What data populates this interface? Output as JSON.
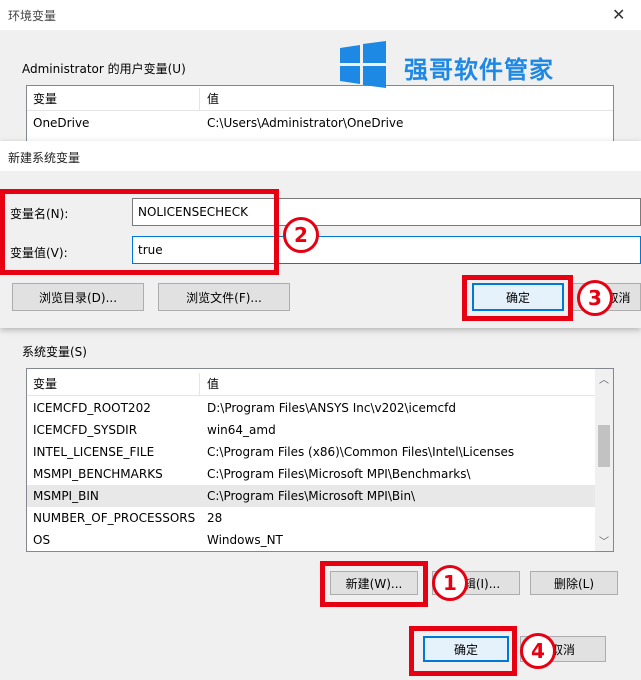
{
  "env_window": {
    "title": "环境变量",
    "close_icon": "close-icon",
    "user_section_label": "Administrator 的用户变量(U)",
    "user_vars": {
      "col_name": "变量",
      "col_value": "值",
      "rows": [
        {
          "name": "OneDrive",
          "value": "C:\\Users\\Administrator\\OneDrive"
        }
      ]
    },
    "sys_section_label": "系统变量(S)",
    "sys_vars": {
      "col_name": "变量",
      "col_value": "值",
      "rows": [
        {
          "name": "ICEMCFD_ROOT202",
          "value": "D:\\Program Files\\ANSYS Inc\\v202\\icemcfd"
        },
        {
          "name": "ICEMCFD_SYSDIR",
          "value": "win64_amd"
        },
        {
          "name": "INTEL_LICENSE_FILE",
          "value": "C:\\Program Files (x86)\\Common Files\\Intel\\Licenses"
        },
        {
          "name": "MSMPI_BENCHMARKS",
          "value": "C:\\Program Files\\Microsoft MPI\\Benchmarks\\"
        },
        {
          "name": "MSMPI_BIN",
          "value": "C:\\Program Files\\Microsoft MPI\\Bin\\"
        },
        {
          "name": "NUMBER_OF_PROCESSORS",
          "value": "28"
        },
        {
          "name": "OS",
          "value": "Windows_NT"
        }
      ]
    },
    "buttons": {
      "new": "新建(W)...",
      "edit": "编辑(I)...",
      "delete": "删除(L)",
      "ok": "确定",
      "cancel": "取消"
    }
  },
  "watermark": {
    "logo_icon": "windows-logo-icon",
    "text": "强哥软件管家",
    "color": "#1e88e5"
  },
  "new_var_dialog": {
    "title": "新建系统变量",
    "name_label": "变量名(N):",
    "name_value": "NOLICENSECHECK",
    "value_label": "变量值(V):",
    "value_value": "true",
    "browse_dir": "浏览目录(D)...",
    "browse_file": "浏览文件(F)...",
    "ok": "确定",
    "cancel": "取消"
  },
  "annotations": {
    "step1": "1",
    "step2": "2",
    "step3": "3",
    "step4": "4",
    "color": "#e60012"
  }
}
